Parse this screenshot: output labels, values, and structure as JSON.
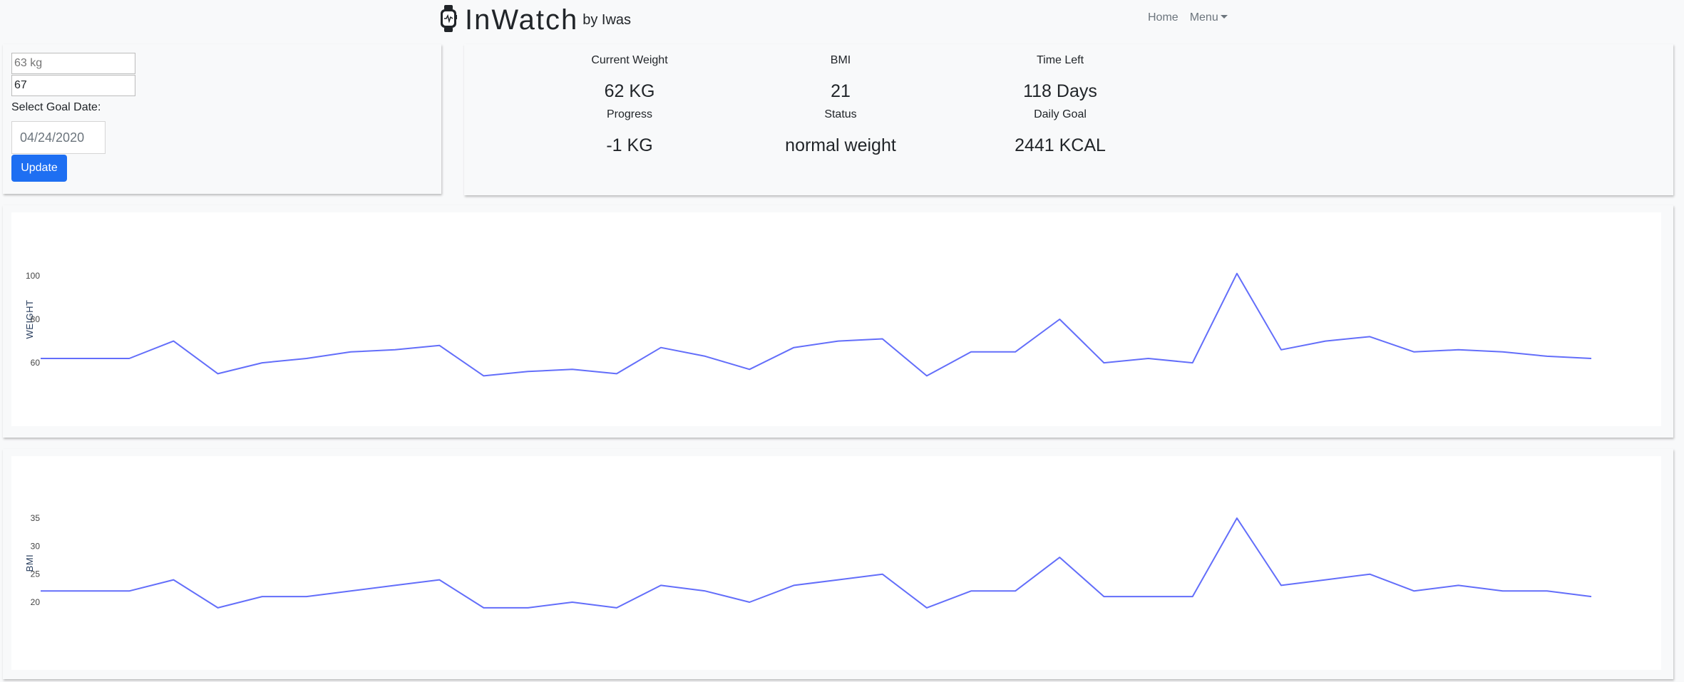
{
  "navbar": {
    "brand_name": "InWatch",
    "brand_by": "by Iwas",
    "links": {
      "home": "Home",
      "menu": "Menu"
    }
  },
  "form": {
    "weight_placeholder": "63 kg",
    "second_value": "67",
    "goal_label": "Select Goal Date:",
    "goal_date": "04/24/2020",
    "update_label": "Update"
  },
  "stats": {
    "current_weight": {
      "label": "Current Weight",
      "value": "62 KG"
    },
    "bmi": {
      "label": "BMI",
      "value": "21"
    },
    "time_left": {
      "label": "Time Left",
      "value": "118 Days"
    },
    "progress": {
      "label": "Progress",
      "value": "-1 KG"
    },
    "status": {
      "label": "Status",
      "value": "normal weight"
    },
    "daily_goal": {
      "label": "Daily Goal",
      "value": "2441 KCAL"
    }
  },
  "colors": {
    "line": "#636efa",
    "button": "#1e6ff2"
  },
  "chart_data": [
    {
      "type": "line",
      "ylabel": "WEIGHT",
      "yticks": [
        60,
        80,
        100
      ],
      "ylim": [
        44,
        116
      ],
      "values": [
        62,
        62,
        62,
        70,
        55,
        60,
        62,
        65,
        66,
        68,
        54,
        56,
        57,
        55,
        67,
        63,
        57,
        67,
        70,
        71,
        54,
        65,
        65,
        80,
        60,
        62,
        60,
        101,
        66,
        70,
        72,
        65,
        66,
        65,
        63,
        62
      ]
    },
    {
      "type": "line",
      "ylabel": "BMI",
      "yticks": [
        20,
        25,
        30,
        35
      ],
      "ylim": [
        13,
        41
      ],
      "values": [
        22,
        22,
        22,
        24,
        19,
        21,
        21,
        22,
        23,
        24,
        19,
        19,
        20,
        19,
        23,
        22,
        20,
        23,
        24,
        25,
        19,
        22,
        22,
        28,
        21,
        21,
        21,
        35,
        23,
        24,
        25,
        22,
        23,
        22,
        22,
        21
      ]
    }
  ]
}
